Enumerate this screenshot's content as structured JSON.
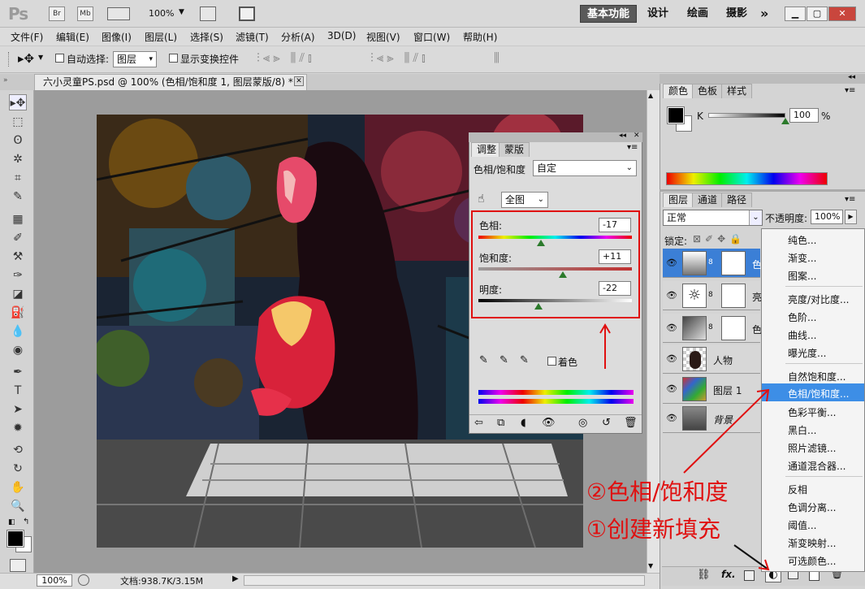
{
  "app": {
    "logo": "Ps",
    "br": "Br",
    "mb": "Mb",
    "zoom": "100%"
  },
  "workspaces": [
    "基本功能",
    "设计",
    "绘画",
    "摄影"
  ],
  "workspaces_more": "»",
  "menu": [
    "文件(F)",
    "编辑(E)",
    "图像(I)",
    "图层(L)",
    "选择(S)",
    "滤镜(T)",
    "分析(A)",
    "3D(D)",
    "视图(V)",
    "窗口(W)",
    "帮助(H)"
  ],
  "options": {
    "auto_select_label": "自动选择:",
    "auto_select_value": "图层",
    "show_transform_label": "显示变换控件"
  },
  "document": {
    "tab_title": "六小灵童PS.psd @ 100% (色相/饱和度 1, 图层蒙版/8) *"
  },
  "status": {
    "zoom": "100%",
    "doc_info": "文档:938.7K/3.15M"
  },
  "adjustments": {
    "tabs": [
      "调整",
      "蒙版"
    ],
    "title": "色相/饱和度",
    "preset": "自定",
    "channel": "全图",
    "hue_label": "色相:",
    "hue_value": "-17",
    "hue_pos": 0.41,
    "sat_label": "饱和度:",
    "sat_value": "+11",
    "sat_pos": 0.55,
    "light_label": "明度:",
    "light_value": "-22",
    "light_pos": 0.39,
    "colorize_label": "着色"
  },
  "color_panel": {
    "tabs": [
      "颜色",
      "色板",
      "样式"
    ],
    "k_label": "K",
    "k_value": "100",
    "percent": "%"
  },
  "layers_panel": {
    "tabs": [
      "图层",
      "通道",
      "路径"
    ],
    "blend_mode": "正常",
    "opacity_label": "不透明度:",
    "opacity_value": "100%",
    "lock_label": "锁定:",
    "layers": [
      {
        "name": "色",
        "selected": true
      },
      {
        "name": "亮",
        "selected": false
      },
      {
        "name": "色",
        "selected": false
      },
      {
        "name": "人物",
        "selected": false
      },
      {
        "name": "图层 1",
        "selected": false
      },
      {
        "name": "背景",
        "selected": false
      }
    ]
  },
  "dropdown": {
    "groups": [
      [
        "纯色...",
        "渐变...",
        "图案..."
      ],
      [
        "亮度/对比度...",
        "色阶...",
        "曲线...",
        "曝光度..."
      ],
      [
        "自然饱和度...",
        "色相/饱和度...",
        "色彩平衡...",
        "黑白...",
        "照片滤镜...",
        "通道混合器..."
      ],
      [
        "反相",
        "色调分离...",
        "阈值...",
        "渐变映射...",
        "可选颜色..."
      ]
    ],
    "highlighted": "色相/饱和度..."
  },
  "annotations": {
    "step2": "②色相/饱和度",
    "step1": "①创建新填充"
  },
  "colors": {
    "accent_red": "#e01010",
    "highlight_blue": "#3d8ee6",
    "selected_layer": "#3b7fd6"
  }
}
